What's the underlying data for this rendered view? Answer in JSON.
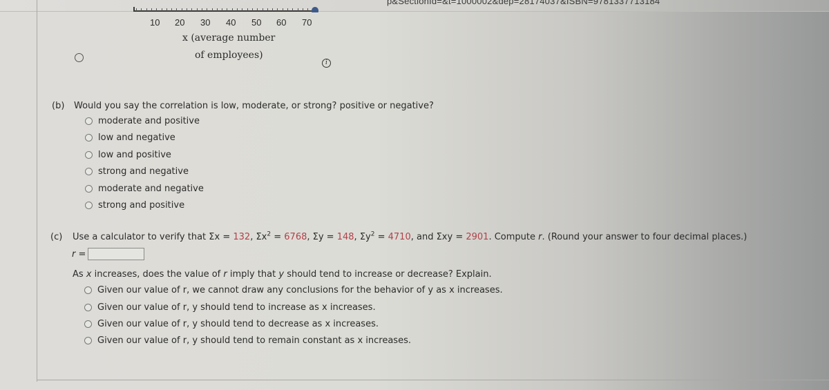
{
  "browser": {
    "url_fragment": "p&SectionId=&t=1000002&dep=28174037&ISBN=9781337713184"
  },
  "chart_axis": {
    "tick_labels": [
      "10",
      "20",
      "30",
      "40",
      "50",
      "60",
      "70"
    ],
    "title_line1": "x (average number",
    "title_line2": "of employees)"
  },
  "icons": {
    "info": "i"
  },
  "part_b": {
    "label": "(b)",
    "question": "Would you say the correlation is low, moderate, or strong? positive or negative?",
    "options": [
      "moderate and positive",
      "low and negative",
      "low and positive",
      "strong and negative",
      "moderate and negative",
      "strong and positive"
    ]
  },
  "part_c": {
    "label": "(c)",
    "intro": "Use a calculator to verify that ",
    "sum_x_label": "Σx = ",
    "sum_x": "132",
    "sum_x2_label": "Σx",
    "sum_x2": "6768",
    "sum_y_label": "Σy = ",
    "sum_y": "148",
    "sum_y2_label": "Σy",
    "sum_y2": "4710",
    "sum_xy_label": "Σxy = ",
    "sum_xy": "2901",
    "outro_1": ". Compute ",
    "outro_r": "r",
    "outro_2": ". (Round your answer to four decimal places.)",
    "r_label": "r =",
    "r_value": "",
    "followup": {
      "pre": "As ",
      "x": "x",
      "mid1": " increases, does the value of ",
      "r": "r",
      "mid2": " imply that ",
      "y": "y",
      "post": " should tend to increase or decrease? Explain."
    },
    "options": [
      "Given our value of r, we cannot draw any conclusions for the behavior of y as x increases.",
      "Given our value of r, y should tend to increase as x increases.",
      "Given our value of r, y should tend to decrease as x increases.",
      "Given our value of r, y should tend to remain constant as x increases."
    ]
  }
}
